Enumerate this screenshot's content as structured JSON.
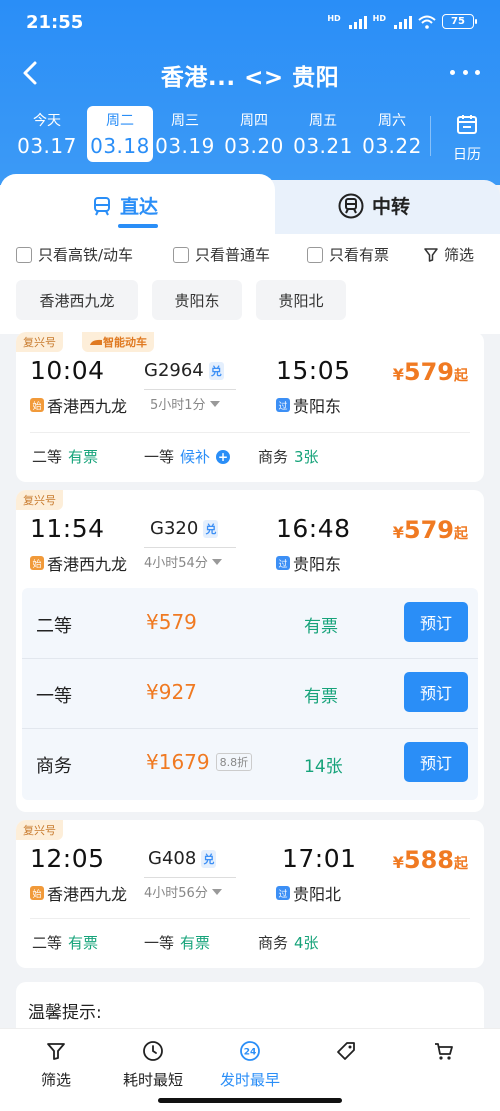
{
  "status": {
    "time": "21:55",
    "hd1": "HD",
    "hd2": "HD",
    "battery": "75"
  },
  "nav": {
    "title": "香港... <> 贵阳"
  },
  "dates": [
    {
      "weekday": "今天",
      "date": "03.17"
    },
    {
      "weekday": "周二",
      "date": "03.18",
      "active": true
    },
    {
      "weekday": "周三",
      "date": "03.19"
    },
    {
      "weekday": "周四",
      "date": "03.20"
    },
    {
      "weekday": "周五",
      "date": "03.21"
    },
    {
      "weekday": "周六",
      "date": "03.22"
    }
  ],
  "calendar_label": "日历",
  "tabs": {
    "direct": "直达",
    "transfer": "中转"
  },
  "filters": {
    "high_speed": "只看高铁/动车",
    "normal": "只看普通车",
    "available": "只看有票",
    "filter": "筛选"
  },
  "stations": [
    "香港西九龙",
    "贵阳东",
    "贵阳北"
  ],
  "trains": [
    {
      "badge": "复兴号",
      "smart_badge": "智能动车",
      "depart_time": "10:04",
      "depart_station": "香港西九龙",
      "depart_tag": "始",
      "train_no": "G2964",
      "dui": "兑",
      "duration": "5小时1分",
      "arrive_time": "15:05",
      "arrive_station": "贵阳东",
      "arrive_tag": "过",
      "price_yen": "¥",
      "price": "579",
      "price_suffix": "起",
      "seats": [
        {
          "name": "二等",
          "status": "有票"
        },
        {
          "name": "一等",
          "status": "候补"
        },
        {
          "name": "商务",
          "status": "3张"
        }
      ]
    },
    {
      "badge": "复兴号",
      "depart_time": "11:54",
      "depart_station": "香港西九龙",
      "depart_tag": "始",
      "train_no": "G320",
      "dui": "兑",
      "duration": "4小时54分",
      "arrive_time": "16:48",
      "arrive_station": "贵阳东",
      "arrive_tag": "过",
      "price_yen": "¥",
      "price": "579",
      "price_suffix": "起",
      "seat_details": [
        {
          "name": "二等",
          "price": "¥579",
          "status": "有票",
          "button": "预订"
        },
        {
          "name": "一等",
          "price": "¥927",
          "status": "有票",
          "button": "预订"
        },
        {
          "name": "商务",
          "price": "¥1679",
          "discount": "8.8折",
          "status": "14张",
          "button": "预订"
        }
      ]
    },
    {
      "badge": "复兴号",
      "depart_time": "12:05",
      "depart_station": "香港西九龙",
      "depart_tag": "始",
      "train_no": "G408",
      "dui": "兑",
      "duration": "4小时56分",
      "arrive_time": "17:01",
      "arrive_station": "贵阳北",
      "arrive_tag": "过",
      "price_yen": "¥",
      "price": "588",
      "price_suffix": "起",
      "seats": [
        {
          "name": "二等",
          "status": "有票"
        },
        {
          "name": "一等",
          "status": "有票"
        },
        {
          "name": "商务",
          "status": "4张"
        }
      ]
    }
  ],
  "tips_title": "温馨提示:",
  "bottom": [
    {
      "label": "筛选",
      "icon": "filter-icon"
    },
    {
      "label": "耗时最短",
      "icon": "clock-icon"
    },
    {
      "label": "发时最早",
      "icon": "24h-icon",
      "icon_text": "24"
    },
    {
      "label": "",
      "icon": "tag-icon"
    },
    {
      "label": "",
      "icon": "cart-icon"
    }
  ],
  "colors": {
    "brand": "#2a8ef7",
    "price": "#f07a22",
    "available": "#16a37a"
  }
}
